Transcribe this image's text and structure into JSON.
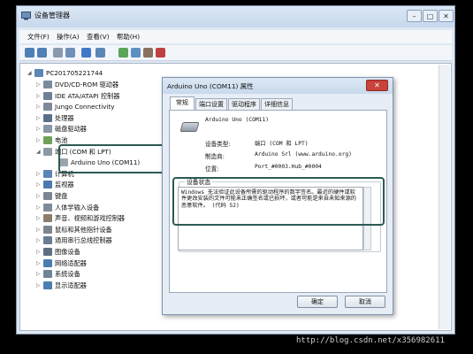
{
  "window": {
    "title": "设备管理器",
    "icon": "device-manager-icon",
    "buttons": {
      "minimize": "–",
      "maximize": "□",
      "close": "✕"
    }
  },
  "menu": [
    "文件(F)",
    "操作(A)",
    "查看(V)",
    "帮助(H)"
  ],
  "toolbar_icons": [
    "back-arrow-icon",
    "forward-arrow-icon",
    "show-hidden-icon",
    "properties-icon",
    "help-icon",
    "computer-icon",
    "update-driver-icon",
    "scan-hardware-icon",
    "disable-device-icon",
    "uninstall-device-icon"
  ],
  "tree": {
    "root": "PC201705221744",
    "items": [
      {
        "label": "DVD/CD-ROM 驱动器",
        "icon": "dvd-drive-icon",
        "color": "#7a8b9e"
      },
      {
        "label": "IDE ATA/ATAPI 控制器",
        "icon": "ide-controller-icon",
        "color": "#6d7f94"
      },
      {
        "label": "Jungo Connectivity",
        "icon": "jungo-icon",
        "color": "#7d8a9b"
      },
      {
        "label": "处理器",
        "icon": "cpu-icon",
        "color": "#58708a"
      },
      {
        "label": "磁盘驱动器",
        "icon": "disk-drive-icon",
        "color": "#8a96a4"
      },
      {
        "label": "电池",
        "icon": "battery-icon",
        "color": "#6fa05a"
      },
      {
        "label": "端口 (COM 和 LPT)",
        "icon": "port-icon",
        "color": "#8c98a5"
      },
      {
        "label": "Arduino Uno (COM11)",
        "icon": "port-device-icon",
        "color": "#9aa4af",
        "child": true
      },
      {
        "label": "计算机",
        "icon": "computer-icon",
        "color": "#5b86b5"
      },
      {
        "label": "监视器",
        "icon": "monitor-icon",
        "color": "#4a79b0"
      },
      {
        "label": "键盘",
        "icon": "keyboard-icon",
        "color": "#7b8591"
      },
      {
        "label": "人体学输入设备",
        "icon": "hid-icon",
        "color": "#7f8b98"
      },
      {
        "label": "声音、视频和游戏控制器",
        "icon": "sound-icon",
        "color": "#8b7d6a"
      },
      {
        "label": "鼠标和其他指针设备",
        "icon": "mouse-icon",
        "color": "#7b8591"
      },
      {
        "label": "通用串行总线控制器",
        "icon": "usb-icon",
        "color": "#6a7c90"
      },
      {
        "label": "图像设备",
        "icon": "camera-icon",
        "color": "#5d6f82"
      },
      {
        "label": "网络适配器",
        "icon": "network-icon",
        "color": "#4c7db0"
      },
      {
        "label": "系统设备",
        "icon": "system-device-icon",
        "color": "#6f8399"
      },
      {
        "label": "显示适配器",
        "icon": "display-adapter-icon",
        "color": "#4b7fb1"
      }
    ]
  },
  "dialog": {
    "title": "Arduino Uno (COM11) 属性",
    "close": "✕",
    "tabs": [
      "常规",
      "端口设置",
      "驱动程序",
      "详细信息"
    ],
    "device_name": "Arduino Uno (COM11)",
    "fields": [
      {
        "label": "设备类型:",
        "value": "端口 (COM 和 LPT)"
      },
      {
        "label": "制造商:",
        "value": "Arduino Srl (www.arduino.org)"
      },
      {
        "label": "位置:",
        "value": "Port_#0003.Hub_#0004"
      }
    ],
    "status_legend": "设备状态",
    "status_text": "Windows 无法验证此设备所需的驱动程序的数字签名。最近的硬件或软件更改安装的文件可能未正确签名或已损坏，或者可能是来自未知来源的恶意软件。 (代码 52)",
    "ok": "确定",
    "cancel": "取消"
  },
  "highlight_color": "#2c5a54",
  "watermark": "http://blog.csdn.net/x356982611"
}
